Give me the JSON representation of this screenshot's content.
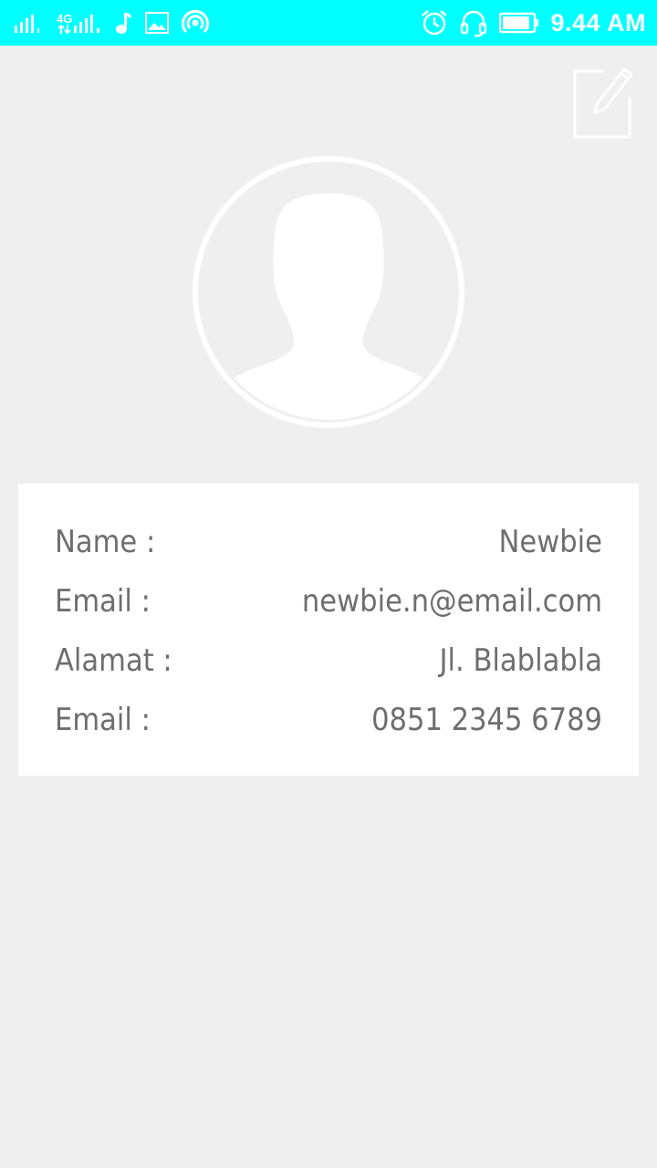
{
  "status_bar": {
    "time": "9.44 AM",
    "network_label": "4G",
    "bg_color": "#00ffff",
    "icons": [
      "signal-sim1-icon",
      "signal-4g-sim2-icon",
      "music-note-icon",
      "image-icon",
      "hotspot-icon",
      "alarm-clock-icon",
      "headset-icon",
      "battery-icon"
    ]
  },
  "toolbar": {
    "edit_icon": "edit-note-icon"
  },
  "profile": {
    "avatar_icon": "person-placeholder-icon",
    "fields": [
      {
        "label": "Name :",
        "value": "Newbie"
      },
      {
        "label": "Email :",
        "value": "newbie.n@email.com"
      },
      {
        "label": "Alamat :",
        "value": "Jl. Blablabla"
      },
      {
        "label": "Email :",
        "value": "0851 2345 6789"
      }
    ]
  },
  "colors": {
    "background": "#efefef",
    "card": "#ffffff",
    "text": "#6e6e6e"
  }
}
